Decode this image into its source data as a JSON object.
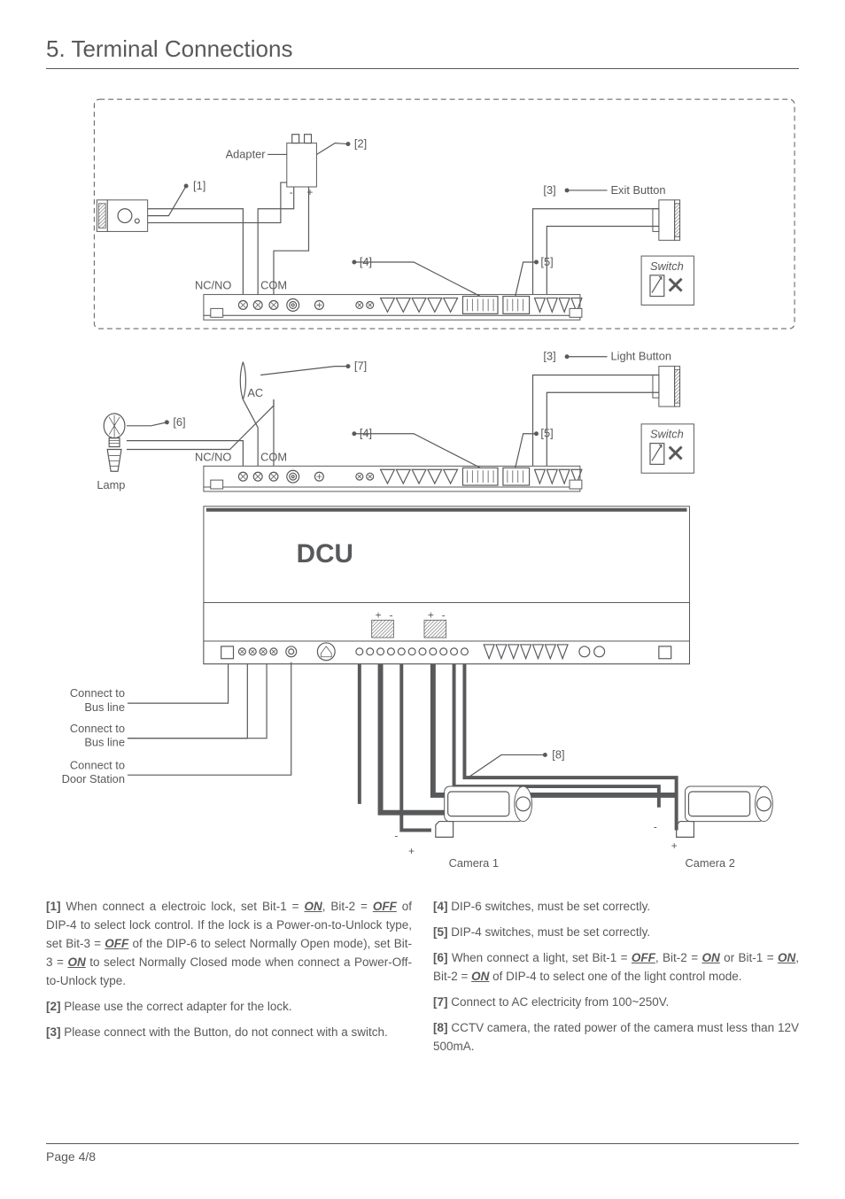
{
  "heading": "5. Terminal Connections",
  "diagram": {
    "adapter": "Adapter",
    "exit_button": "Exit Button",
    "light_button": "Light Button",
    "switch": "Switch",
    "nc_no": "NC/NO",
    "com": "COM",
    "ac": "AC",
    "lamp": "Lamp",
    "dcu": "DCU",
    "connect_bus": "Connect to",
    "connect_bus2": "Bus line",
    "connect_ds": "Connect to",
    "connect_ds2": "Door Station",
    "camera1": "Camera 1",
    "camera2": "Camera 2",
    "minus": "-",
    "plus": "+",
    "refs": {
      "1": "[1]",
      "2": "[2]",
      "3": "[3]",
      "4": "[4]",
      "5": "[5]",
      "6": "[6]",
      "7": "[7]",
      "8": "[8]"
    }
  },
  "notes": {
    "n1_a": "[1]",
    "n1_b": " When connect a electroic lock, set Bit-1 = ",
    "n1_c": "ON",
    "n1_d": ", Bit-2 = ",
    "n1_e": "OFF",
    "n1_f": " of DIP-4 to select lock control. If the lock is a Power-on-to-Unlock type, set Bit-3 = ",
    "n1_g": "OFF",
    "n1_h": " of the DIP-6 to select Normally Open mode), set Bit-3 = ",
    "n1_i": "ON",
    "n1_j": " to select Normally Closed mode when connect a Power-Off-to-Unlock type.",
    "n2_a": "[2]",
    "n2_b": " Please use the correct adapter for the lock.",
    "n3_a": "[3]",
    "n3_b": " Please connect with the Button, do not connect with a switch.",
    "n4_a": "[4]",
    "n4_b": " DIP-6 switches, must be set correctly.",
    "n5_a": "[5]",
    "n5_b": " DIP-4 switches, must be set correctly.",
    "n6_a": "[6]",
    "n6_b": " When connect a light, set Bit-1 = ",
    "n6_c": "OFF",
    "n6_d": ", Bit-2 = ",
    "n6_e": "ON",
    "n6_f": " or Bit-1 = ",
    "n6_g": "ON",
    "n6_h": ", Bit-2 = ",
    "n6_i": "ON",
    "n6_j": " of DIP-4 to select one of the light control mode.",
    "n7_a": "[7]",
    "n7_b": " Connect to AC electricity from 100~250V.",
    "n8_a": "[8]",
    "n8_b": " CCTV camera, the rated power of the camera must less than 12V 500mA."
  },
  "footer": {
    "page": "Page  4/8"
  }
}
